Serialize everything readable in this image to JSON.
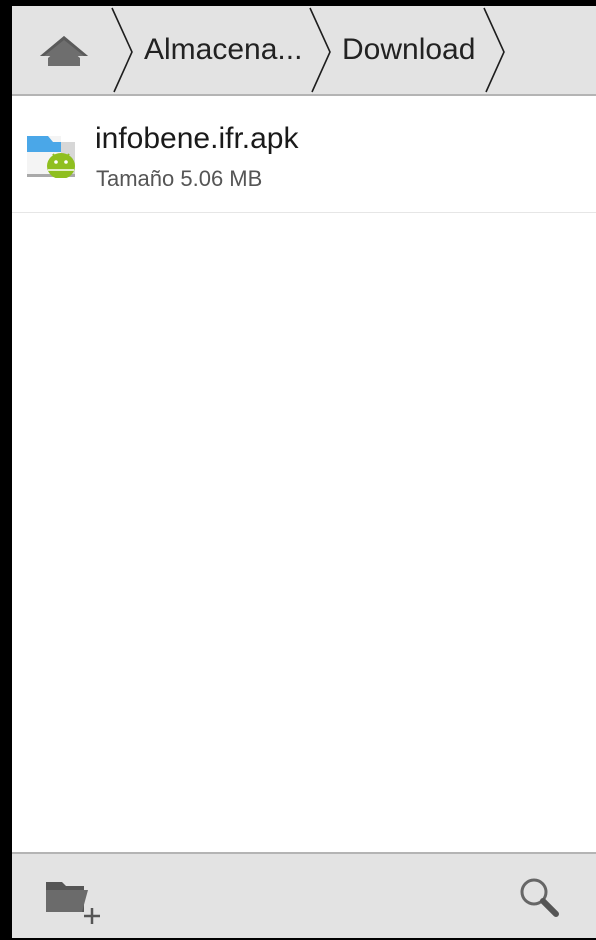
{
  "breadcrumb": {
    "home_icon": "home-icon",
    "items": [
      {
        "label": "Almacena..."
      },
      {
        "label": "Download"
      }
    ]
  },
  "files": [
    {
      "name": "infobene.ifr.apk",
      "size": "Tamaño 5.06 MB",
      "icon": "apk-file-icon"
    }
  ],
  "toolbar": {
    "new_folder_icon": "new-folder-icon",
    "search_icon": "search-icon"
  },
  "colors": {
    "bar_background": "#e3e3e3",
    "bar_border": "#b4b4b4",
    "android_green": "#8fbf1f",
    "icon_gray": "#666666"
  }
}
